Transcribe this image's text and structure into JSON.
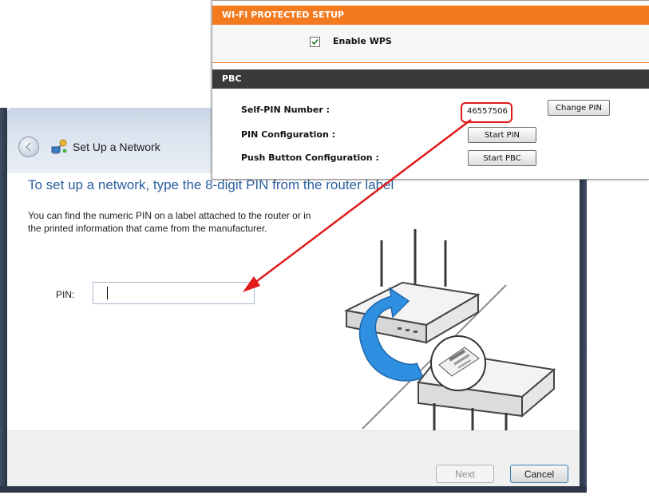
{
  "wizard": {
    "title": "Set Up a Network",
    "heading": "To set up a network, type the 8-digit PIN from the router label",
    "description": "You can find the numeric PIN on a label attached to the router or in the printed information that came from the manufacturer.",
    "pin_label": "PIN:",
    "pin_value": "",
    "next_label": "Next",
    "cancel_label": "Cancel",
    "icons": {
      "back": "back-arrow-icon",
      "network": "network-setup-icon",
      "illustration": "router-illustration"
    }
  },
  "router_panel": {
    "wps_section_title": "WI-FI PROTECTED SETUP",
    "enable_wps_label": "Enable WPS",
    "enable_wps_checked": true,
    "pbc_section_title": "PBC",
    "self_pin_label": "Self-PIN Number :",
    "self_pin_value": "46557506",
    "change_pin_label": "Change PIN",
    "pin_config_label": "PIN Configuration :",
    "start_pin_label": "Start PIN",
    "push_button_label": "Push Button Configuration :",
    "start_pbc_label": "Start PBC"
  },
  "colors": {
    "wps_header": "#f47a1f",
    "pbc_header": "#3a3a3a",
    "heading_blue": "#2b5e9e",
    "annotation_red": "#e01a1a"
  }
}
